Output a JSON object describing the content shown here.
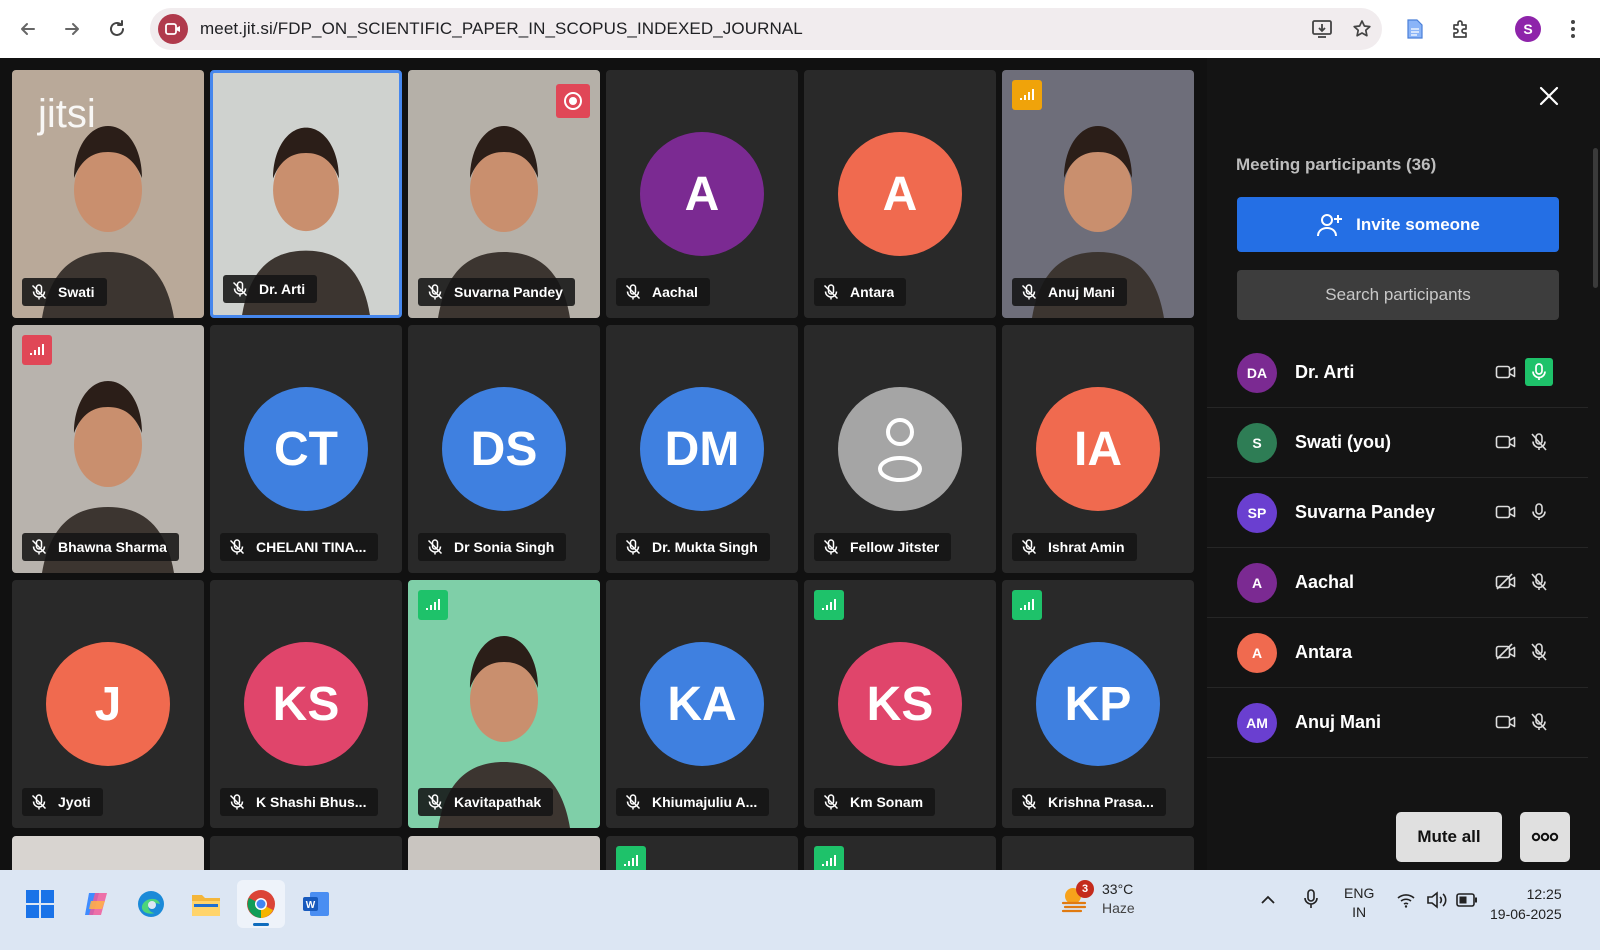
{
  "browser": {
    "url": "meet.jit.si/FDP_ON_SCIENTIFIC_PAPER_IN_SCOPUS_INDEXED_JOURNAL",
    "profile_initial": "S"
  },
  "watermark": "jitsi",
  "tiles": [
    {
      "name": "Swati",
      "type": "video",
      "bg": "#b9a999"
    },
    {
      "name": "Dr. Arti",
      "type": "video",
      "bg": "#cfd2cf",
      "active": true
    },
    {
      "name": "Suvarna Pandey",
      "type": "video",
      "bg": "#b5b0a8",
      "recording": true
    },
    {
      "name": "Aachal",
      "initials": "A",
      "color": "#7b2a92"
    },
    {
      "name": "Antara",
      "initials": "A",
      "color": "#f06a4f"
    },
    {
      "name": "Anuj Mani",
      "type": "video",
      "bg": "#6e6e7a",
      "signal": "#f0a30a"
    },
    {
      "name": "Bhawna Sharma",
      "type": "video",
      "bg": "#b8b3ad",
      "signal": "#e04757"
    },
    {
      "name": "CHELANI TINA...",
      "initials": "CT",
      "color": "#3f80e0"
    },
    {
      "name": "Dr Sonia Singh",
      "initials": "DS",
      "color": "#3f80e0"
    },
    {
      "name": "Dr. Mukta Singh",
      "initials": "DM",
      "color": "#3f80e0"
    },
    {
      "name": "Fellow Jitster",
      "initials": "",
      "color": "#a5a5a5",
      "generic": true
    },
    {
      "name": "Ishrat Amin",
      "initials": "IA",
      "color": "#f06a4f"
    },
    {
      "name": "Jyoti",
      "initials": "J",
      "color": "#f06a4f"
    },
    {
      "name": "K Shashi Bhus...",
      "initials": "KS",
      "color": "#e0456b"
    },
    {
      "name": "Kavitapathak",
      "type": "video",
      "bg": "#7fcfa8",
      "signal": "#1ec26a"
    },
    {
      "name": "Khiumajuliu A...",
      "initials": "KA",
      "color": "#3f80e0"
    },
    {
      "name": "Km Sonam",
      "initials": "KS",
      "color": "#e0456b",
      "signal": "#1ec26a"
    },
    {
      "name": "Krishna Prasa...",
      "initials": "KP",
      "color": "#3f80e0",
      "signal": "#1ec26a"
    }
  ],
  "panel": {
    "title": "Meeting participants (36)",
    "invite_label": "Invite someone",
    "search_placeholder": "Search participants",
    "participants": [
      {
        "initials": "DA",
        "name": "Dr. Arti",
        "color": "#7b2a92",
        "mic": "on",
        "cam": "on"
      },
      {
        "initials": "S",
        "name": "Swati (you)",
        "color": "#2e7d55",
        "mic": "off",
        "cam": "on"
      },
      {
        "initials": "SP",
        "name": "Suvarna Pandey",
        "color": "#6a3fd0",
        "mic": "idle",
        "cam": "on"
      },
      {
        "initials": "A",
        "name": "Aachal",
        "color": "#7b2a92",
        "mic": "off",
        "cam": "off"
      },
      {
        "initials": "A",
        "name": "Antara",
        "color": "#f06a4f",
        "mic": "off",
        "cam": "off"
      },
      {
        "initials": "AM",
        "name": "Anuj Mani",
        "color": "#6a3fd0",
        "mic": "off",
        "cam": "on"
      }
    ],
    "mute_all_label": "Mute all"
  },
  "taskbar": {
    "weather_badge": "3",
    "temperature": "33°C",
    "condition": "Haze",
    "lang_top": "ENG",
    "lang_bottom": "IN",
    "time": "12:25",
    "date": "19-06-2025"
  }
}
